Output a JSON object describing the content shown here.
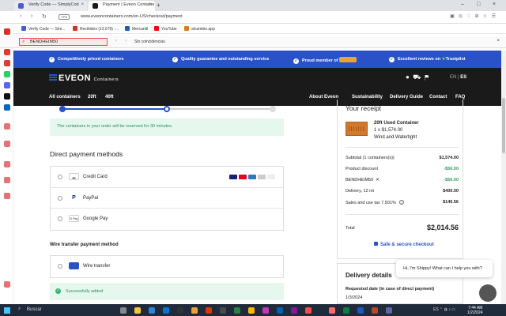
{
  "browser": {
    "tabs": [
      {
        "label": "Verify Code — SimplyCod"
      },
      {
        "label": "Payment | Eveon Containe"
      }
    ],
    "new_tab": "+",
    "url": "www.eveoncontainers.com/en-US/checkout/payment",
    "vpn": "VPN",
    "bookmarks": [
      {
        "label": "Verify Code — Sim...",
        "color": "#4a5bd3"
      },
      {
        "label": "Recibidos (13.678) -...",
        "color": "#d93025"
      },
      {
        "label": "Mercantil",
        "color": "#1d5fb5"
      },
      {
        "label": "YouTube",
        "color": "#ff0000"
      },
      {
        "label": "alcambio.app",
        "color": "#e07b1a"
      }
    ],
    "find": {
      "query": "BENDHEIM50",
      "status": "Sin coincidencias."
    }
  },
  "promo": {
    "items": [
      "Competitively priced containers",
      "Quality guarantee and outstanding service",
      "Proud member of",
      "Excellent reviews on",
      "Trustpilot"
    ]
  },
  "header": {
    "logo": "EVEON",
    "logo_sub": "Containers",
    "lang_en": "EN",
    "lang_es": "ES",
    "nav_left": [
      "All containers",
      "20ft",
      "40ft"
    ],
    "nav_right": [
      "About Eveon",
      "Sustainability",
      "Delivery Guide",
      "Contact",
      "FAQ"
    ]
  },
  "checkout": {
    "reservation_notice": "The containers in your order will be reserved for 30 minutes.",
    "direct_title": "Direct payment methods",
    "direct_methods": [
      {
        "label": "Credit Card",
        "icon": "credit-card-icon"
      },
      {
        "label": "PayPal",
        "icon": "paypal-icon"
      },
      {
        "label": "Google Pay",
        "icon": "google-pay-icon"
      }
    ],
    "wire_title": "Wire transfer payment method",
    "wire_methods": [
      {
        "label": "Wire transfer",
        "icon": "bank-icon"
      }
    ],
    "success": "Successfully added"
  },
  "receipt": {
    "title": "Your receipt",
    "product_name": "20ft Used Container",
    "product_qty": "1 x $1,574.00",
    "product_condition": "Wind and Watertight",
    "rows": [
      {
        "label": "Subtotal (1 containers(s))",
        "value": "$1,574.00",
        "green": false
      },
      {
        "label": "Product discount",
        "value": "-$50.00",
        "green": true
      },
      {
        "label": "BENDHEIM50",
        "value": "-$50.00",
        "green": true
      },
      {
        "label": "Delivery, 12 mi",
        "value": "$400.00",
        "green": false
      },
      {
        "label": "Sales and use tax 7.501%",
        "value": "$140.56",
        "green": false
      }
    ],
    "total_label": "Total",
    "total_value": "$2,014.56",
    "secure_label": "Safe & secure checkout"
  },
  "delivery": {
    "title": "Delivery details",
    "requested_label": "Requested date (in case of direct payment)",
    "requested_date": "1/3/2024"
  },
  "chat": {
    "message": "Hi, I'm Shippy! What can I help you with?"
  },
  "taskbar": {
    "search": "Buscar",
    "tray_lang": "ES",
    "time": "7:44 AM",
    "date": "1/2/2024"
  },
  "colors": {
    "brand_blue": "#2952c8",
    "header_dark": "#1a1a1a",
    "success_green": "#2a9d5a"
  }
}
